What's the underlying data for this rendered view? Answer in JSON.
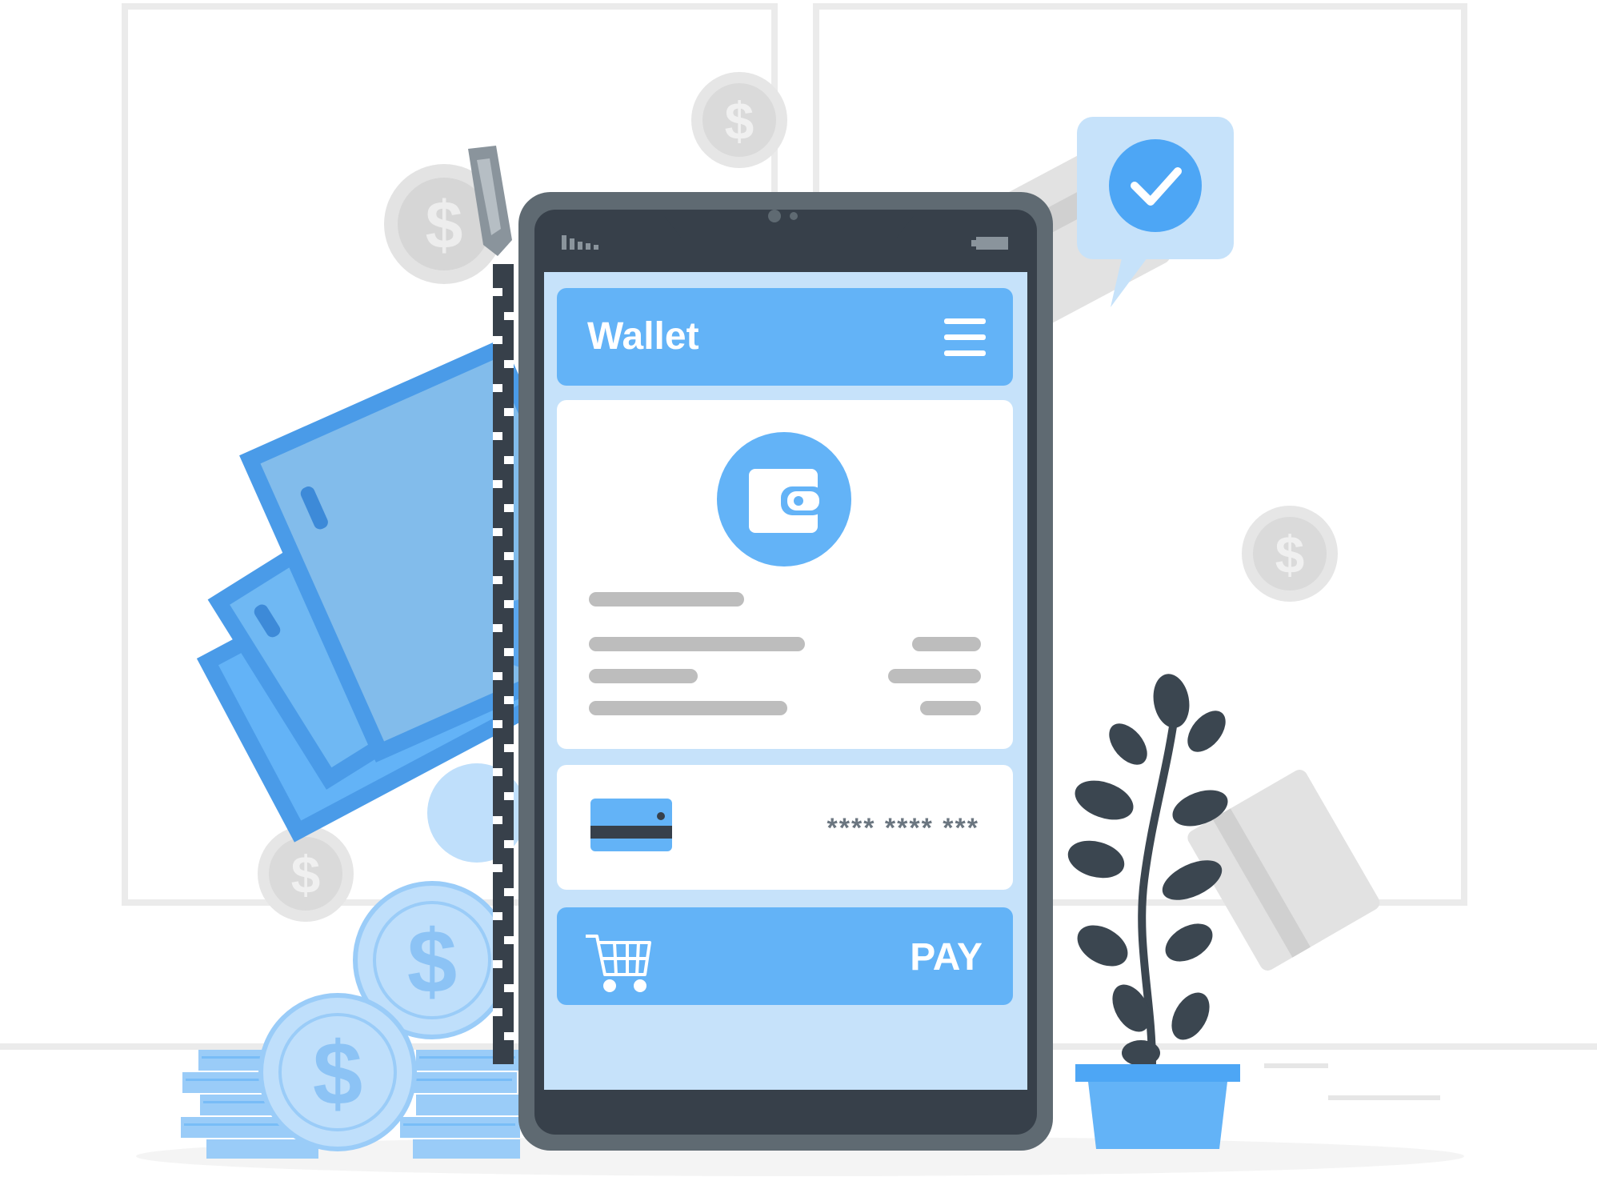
{
  "app": {
    "header_title": "Wallet",
    "card_number_masked": "**** **** ***",
    "pay_label": "PAY"
  },
  "icons": {
    "menu": "hamburger-menu-icon",
    "wallet": "wallet-icon",
    "card": "credit-card-icon",
    "cart": "shopping-cart-icon",
    "check": "checkmark-icon",
    "signal": "signal-icon",
    "battery": "battery-icon",
    "dollar": "dollar-coin-icon"
  },
  "colors": {
    "primary": "#63B3F7",
    "primary_dark": "#4A9BE8",
    "screen_bg": "#C6E2FA",
    "phone_frame": "#5F6A72",
    "phone_dark": "#37404A",
    "placeholder_gray": "#BDBDBD",
    "coin_light": "#BFDFFB",
    "plant_dark": "#3B4650"
  }
}
